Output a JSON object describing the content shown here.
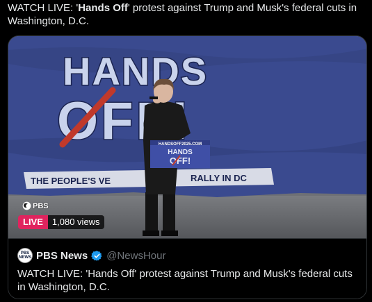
{
  "post": {
    "text_prefix": "WATCH LIVE: '",
    "text_bold": "Hands Off",
    "text_suffix": "' protest against Trump and Musk's federal cuts in Washington, D.C."
  },
  "video": {
    "banner_line1": "HANDS",
    "banner_line2": "OFF!",
    "banner_tagline_left": "THE PEOPLE'S VE",
    "banner_tagline_right": "RALLY IN DC",
    "podium_url": "HANDSOFF2025.COM",
    "podium_line1": "HANDS",
    "podium_line2": "OFF!",
    "network_logo": "PBS",
    "live_label": "LIVE",
    "views": "1,080 views"
  },
  "card": {
    "author_name": "PBS News",
    "avatar_text": "PBS NEWS",
    "handle": "@NewsHour",
    "title": "WATCH LIVE: 'Hands Off' protest against Trump and Musk's federal cuts in Washington, D.C."
  },
  "colors": {
    "banner_blue": "#3a4a8f",
    "banner_red": "#c0392b",
    "live_red": "#e0245e",
    "verified_blue": "#1d9bf0"
  }
}
